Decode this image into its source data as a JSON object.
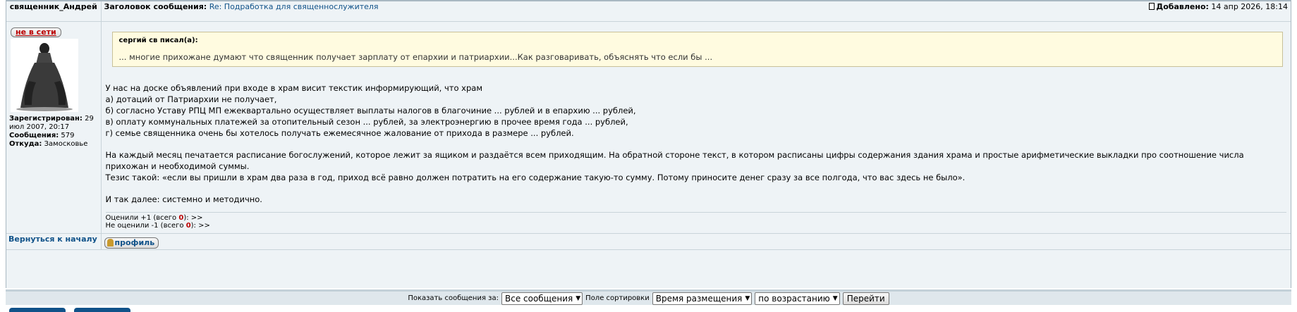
{
  "post": {
    "author": "священник_Андрей",
    "subject_label": "Заголовок сообщения:",
    "subject_link": "Re: Подработка для священнослужителя",
    "posted_label": "Добавлено:",
    "posted_date": "14 апр 2026, 18:14",
    "status": "не в сети",
    "meta": {
      "registered_label": "Зарегистрирован:",
      "registered_value": "29 июл 2007, 20:17",
      "posts_label": "Сообщения:",
      "posts_value": "579",
      "from_label": "Откуда:",
      "from_value": "Замосковье"
    },
    "quote": {
      "title": "сергий св писал(а):",
      "text": "... многие прихожане думают что священник получает зарплату от епархии и патриархии...Как разговаривать, объяснять что если бы ..."
    },
    "body": {
      "p1": [
        "У нас на доске объявлений при входе в храм висит текстик информирующий, что храм",
        "а) дотаций от Патриархии не получает,",
        "б) согласно Уставу РПЦ МП ежеквартально осуществляет выплаты налогов в благочиние ... рублей и в епархию ... рублей,",
        "в) оплату коммунальных платежей за отопительный сезон ... рублей, за электроэнергию в прочее время года ... рублей,",
        "г) семье священника очень бы хотелось получать ежемесячное жалование от прихода в размере ... рублей."
      ],
      "p2": [
        "На каждый месяц печатается расписание богослужений, которое лежит за ящиком и раздаётся всем приходящим. На обратной стороне текст, в котором расписаны цифры содержания здания храма и простые арифметические выкладки про соотношение числа прихожан и необходимой суммы.",
        "Тезис такой: «если вы пришли в храм два раза в год, приход всё равно должен потратить на его содержание такую-то сумму. Потому приносите денег сразу за все полгода, что вас здесь не было»."
      ],
      "p3": "И так далее: системно и методично."
    },
    "votes": {
      "plus_prefix": "Оценили +1 (всего ",
      "plus_count": "0",
      "plus_suffix": "): >>",
      "minus_prefix": "Не оценили -1 (всего ",
      "minus_count": "0",
      "minus_suffix": "): >>"
    },
    "back_link": "Вернуться к началу",
    "profile_button": "профиль"
  },
  "bottom_bar": {
    "show_label": "Показать сообщения за:",
    "period_value": "Все сообщения",
    "sort_label": "Поле сортировки",
    "sort_value": "Время размещения",
    "order_value": "по возрастанию",
    "go_button": "Перейти"
  },
  "colors": {
    "link": "#105289",
    "accent_red": "#bb0000",
    "quote_bg": "#fffbe0"
  },
  "icons": [
    "post-icon",
    "avatar-image",
    "profile-icon",
    "chevron-down-icon"
  ]
}
